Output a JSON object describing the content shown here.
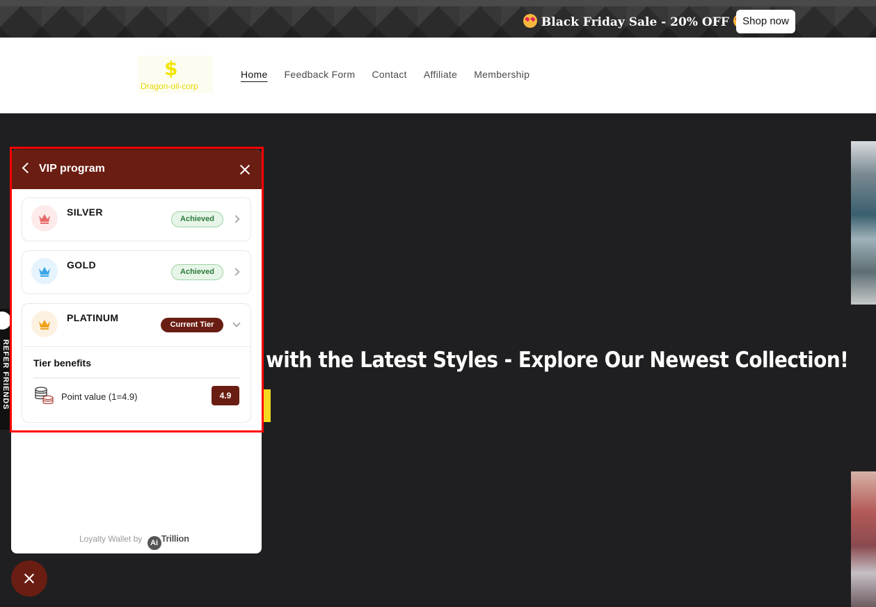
{
  "announcement": {
    "text": "Black Friday Sale - 20% OFF",
    "emoji_icon": "heart-eyes-emoji-icon",
    "shop_label": "Shop now"
  },
  "header": {
    "logo_text": "Dragon-oil-corp",
    "logo_symbol": "$",
    "nav": [
      "Home",
      "Feedback Form",
      "Contact",
      "Affiliate",
      "Membership"
    ],
    "active_nav": "Home"
  },
  "hero": {
    "headline": "with the Latest Styles - Explore Our Newest Collection!"
  },
  "side_tab": {
    "label": "REFER FRIENDS"
  },
  "widget": {
    "title": "VIP program",
    "tiers": [
      {
        "name": "SILVER",
        "status": "Achieved",
        "crown_color": "#e86a6a",
        "circle_color": "#fdeaea"
      },
      {
        "name": "GOLD",
        "status": "Achieved",
        "crown_color": "#3aa6e8",
        "circle_color": "#e5f3fc"
      },
      {
        "name": "PLATINUM",
        "status": "Current Tier",
        "crown_color": "#f0a019",
        "circle_color": "#fdf1e2"
      }
    ],
    "benefits_title": "Tier benefits",
    "benefits": [
      {
        "label": "Point value (1=4.9)",
        "value": "4.9"
      }
    ],
    "powered_by": "Loyalty Wallet by",
    "brand_logo": "Ai",
    "brand_name": "Trillion"
  },
  "colors": {
    "accent": "#6a1d12",
    "highlight": "#ff0000",
    "hero_bg": "#1f1f21"
  }
}
